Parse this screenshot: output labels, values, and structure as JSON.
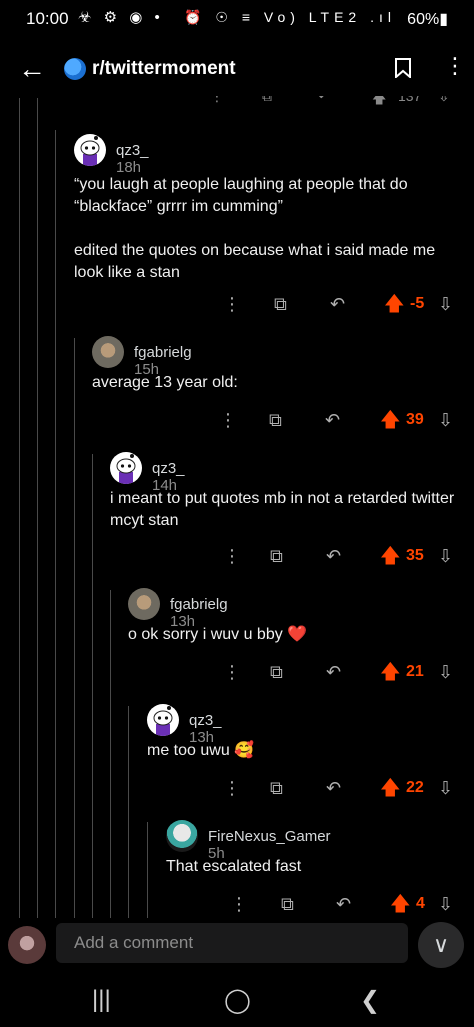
{
  "status_bar": {
    "time": "10:00",
    "left_icons": "☣ ⚙ ◉ •",
    "right_icons": "⏰ ☉ ≡ Vo) LTE2 .ıl",
    "battery": "60%▮"
  },
  "header": {
    "back_glyph": "←",
    "subreddit": "r/twittermoment",
    "more_glyph": "⋮"
  },
  "top_actions": {
    "score": "137"
  },
  "comments": [
    {
      "username": "qz3_",
      "time": "18h",
      "body": "“you laugh at people laughing at people that do “blackface” grrrr im cumming”\n\nedited the quotes on because what i said made me look like a stan",
      "score": "-5"
    },
    {
      "username": "fgabrielg",
      "time": "15h",
      "body": "average 13 year old:",
      "score": "39"
    },
    {
      "username": "qz3_",
      "time": "14h",
      "body": "i meant to put quotes mb in not a retarded twitter mcyt stan",
      "score": "35"
    },
    {
      "username": "fgabrielg",
      "time": "13h",
      "body": "o ok sorry i wuv u bby ❤️",
      "score": "21"
    },
    {
      "username": "qz3_",
      "time": "13h",
      "body": "me too uwu 🥰",
      "score": "22"
    },
    {
      "username": "FireNexus_Gamer",
      "time": "5h",
      "body": "That escalated fast",
      "score": "4"
    }
  ],
  "action_glyphs": {
    "more": "⋮",
    "award": "⧉",
    "reply": "↶",
    "upvote": "🡅",
    "downvote": "⇩"
  },
  "composer": {
    "placeholder": "Add a comment",
    "collapse_glyph": "∨"
  },
  "nav_bar": {
    "recents": "|||",
    "home": "◯",
    "back": "❮"
  },
  "colors": {
    "background": "#000000",
    "upvote_accent": "#ff4500",
    "thread_line": "#4a4a4a"
  }
}
